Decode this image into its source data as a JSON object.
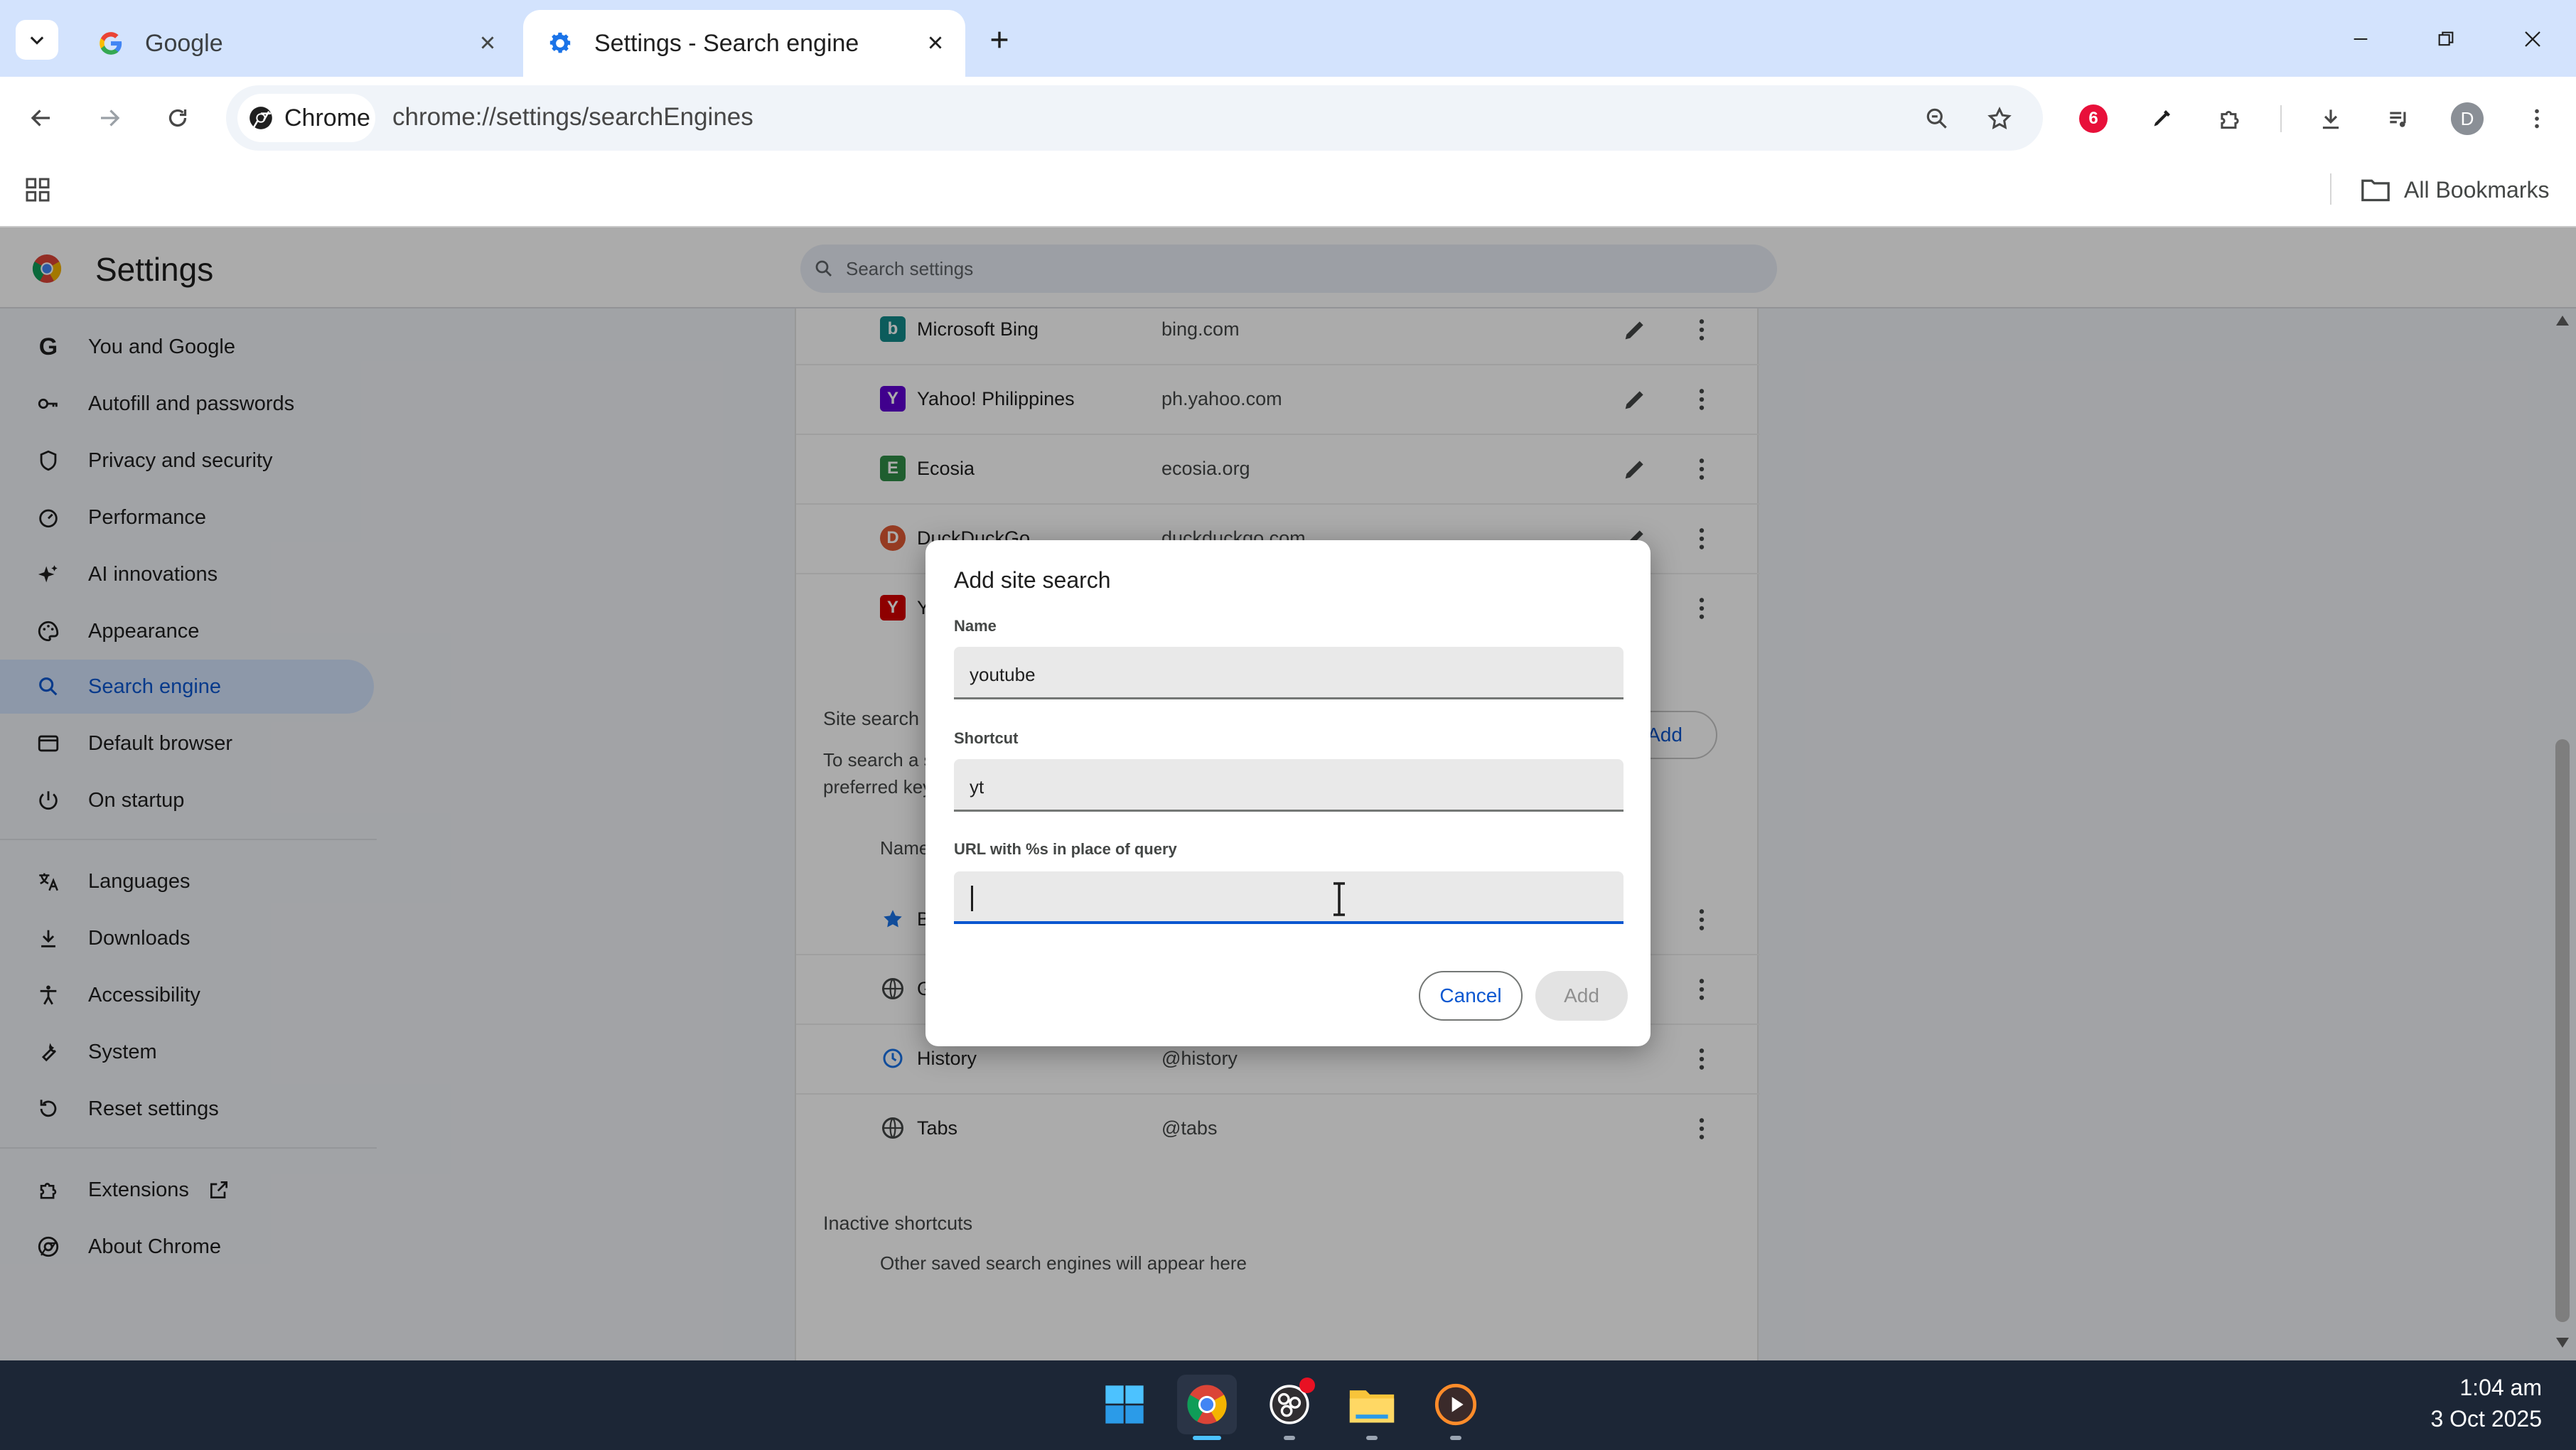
{
  "browser": {
    "tabs": [
      {
        "title": "Google",
        "active": false
      },
      {
        "title": "Settings - Search engine",
        "active": true
      }
    ],
    "chip_label": "Chrome",
    "url": "chrome://settings/searchEngines",
    "all_bookmarks": "All Bookmarks",
    "profile_initial": "D",
    "extension_badge": "6"
  },
  "settings": {
    "title": "Settings",
    "search_placeholder": "Search settings",
    "nav": [
      {
        "label": "You and Google",
        "icon": "google-g-icon"
      },
      {
        "label": "Autofill and passwords",
        "icon": "key-icon"
      },
      {
        "label": "Privacy and security",
        "icon": "shield-icon"
      },
      {
        "label": "Performance",
        "icon": "speedometer-icon"
      },
      {
        "label": "AI innovations",
        "icon": "sparkle-icon"
      },
      {
        "label": "Appearance",
        "icon": "palette-icon"
      },
      {
        "label": "Search engine",
        "icon": "search-icon",
        "active": true
      },
      {
        "label": "Default browser",
        "icon": "browser-window-icon"
      },
      {
        "label": "On startup",
        "icon": "power-icon"
      },
      {
        "label": "Languages",
        "icon": "translate-icon"
      },
      {
        "label": "Downloads",
        "icon": "download-icon"
      },
      {
        "label": "Accessibility",
        "icon": "accessibility-icon"
      },
      {
        "label": "System",
        "icon": "wrench-icon"
      },
      {
        "label": "Reset settings",
        "icon": "reset-icon"
      },
      {
        "label": "Extensions",
        "icon": "puzzle-icon"
      },
      {
        "label": "About Chrome",
        "icon": "chrome-icon"
      }
    ],
    "engines": [
      {
        "name": "Microsoft Bing",
        "keyword": "bing.com",
        "color": "#138a8a"
      },
      {
        "name": "Yahoo! Philippines",
        "keyword": "ph.yahoo.com",
        "color": "#6001d2"
      },
      {
        "name": "Ecosia",
        "keyword": "ecosia.org",
        "color": "#2f8c47"
      },
      {
        "name": "DuckDuckGo",
        "keyword": "duckduckgo.com",
        "color": "#de5833"
      },
      {
        "name": "Y",
        "keyword": "",
        "color": "#d40000"
      }
    ],
    "site_search": {
      "title": "Site search",
      "desc_line1": "To search a s",
      "desc_line2": "preferred key",
      "add_label": "Add",
      "name_col": "Name",
      "rows": [
        {
          "name": "B",
          "keyword": ""
        },
        {
          "name": "G",
          "keyword": ""
        },
        {
          "name": "History",
          "keyword": "@history"
        },
        {
          "name": "Tabs",
          "keyword": "@tabs"
        }
      ]
    },
    "inactive": {
      "title": "Inactive shortcuts",
      "text": "Other saved search engines will appear here"
    }
  },
  "dialog": {
    "title": "Add site search",
    "name_label": "Name",
    "name_value": "youtube",
    "shortcut_label": "Shortcut",
    "shortcut_value": "yt",
    "url_label": "URL with %s in place of query",
    "url_value": "",
    "cancel_label": "Cancel",
    "add_label": "Add"
  },
  "taskbar": {
    "time": "1:04 am",
    "date": "3 Oct 2025"
  },
  "colors": {
    "accent": "#0b57d0",
    "tab_strip": "#d3e3fd",
    "taskbar": "#1c2636"
  }
}
